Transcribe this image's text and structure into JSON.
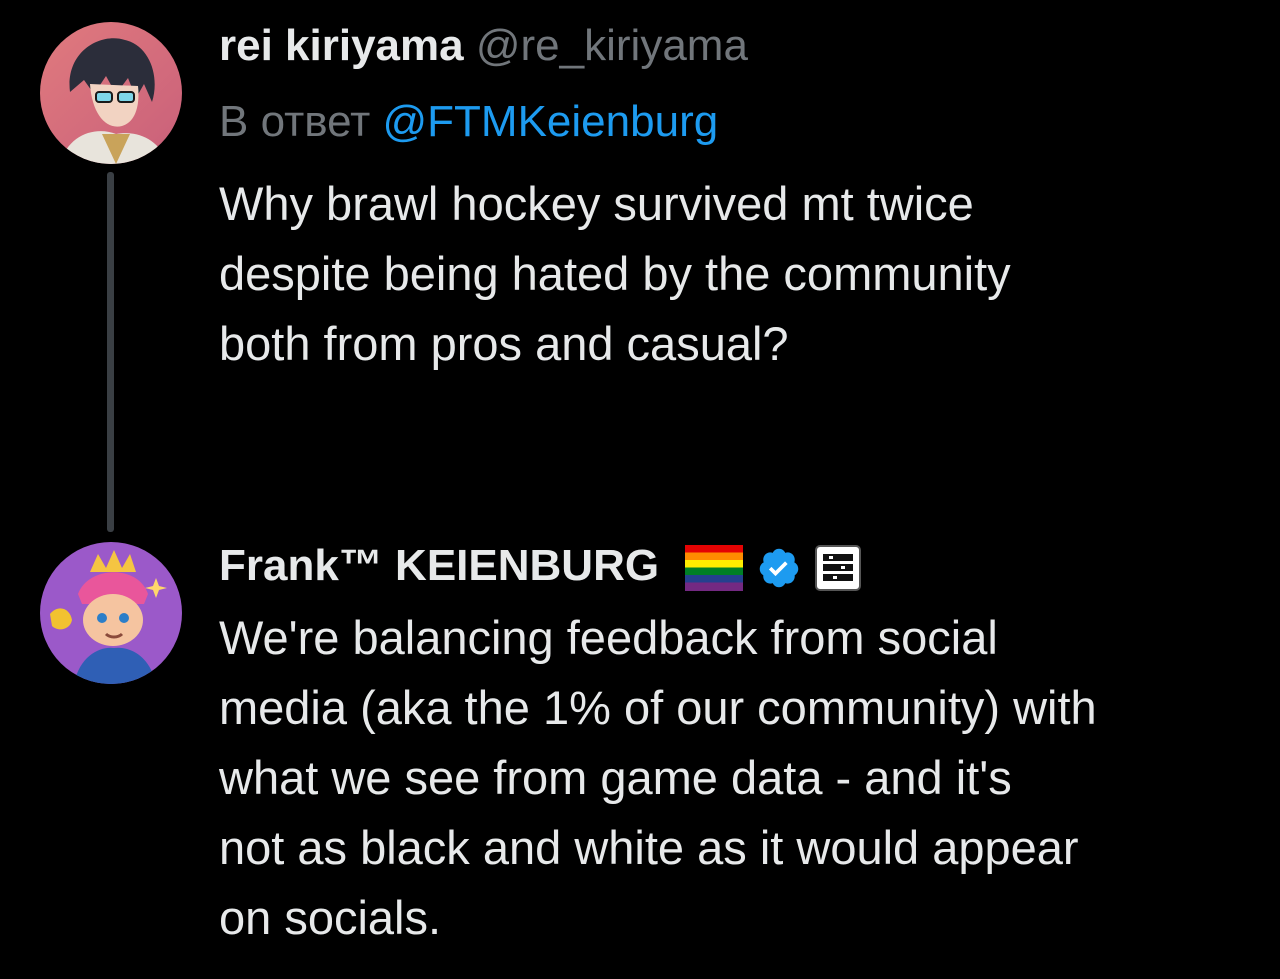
{
  "tweets": [
    {
      "display_name": "rei kiriyama",
      "handle": "@re_kiriyama",
      "reply_prefix": "В ответ",
      "reply_to": "@FTMKeienburg",
      "text": "Why brawl hockey survived mt twice\ndespite being hated by the community\nboth from pros and casual?",
      "avatar_icon": "anime-character-avatar"
    },
    {
      "display_name": "Frank™ KEIENBURG",
      "handle": "",
      "badges": [
        "rainbow-flag-icon",
        "verified-badge-icon",
        "supercell-affiliate-icon"
      ],
      "text": "We're balancing feedback from social\nmedia (aka the 1% of our community) with\nwhat we see from game data - and it's\nnot as black and white as it would appear\non socials.",
      "avatar_icon": "brawl-stars-character-avatar"
    }
  ],
  "colors": {
    "background": "#000000",
    "text": "#e7e9ea",
    "secondary": "#71767b",
    "link": "#1d9bf0",
    "verified": "#1d9bf0"
  }
}
